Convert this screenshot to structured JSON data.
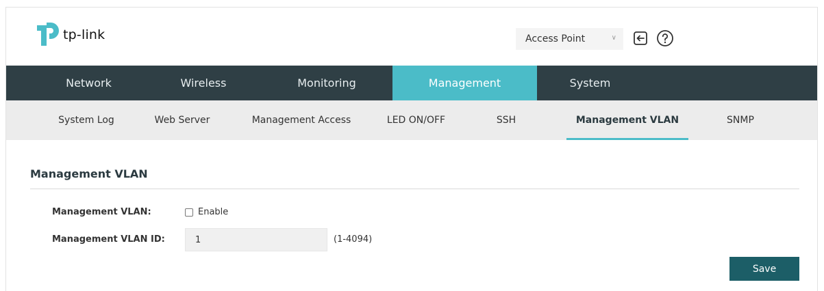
{
  "brand": {
    "name": "tp-link",
    "accent_color": "#4bbcc8",
    "logo_color": "#4bbcc8"
  },
  "header": {
    "mode_select": {
      "value": "Access Point"
    },
    "logout_icon": "logout-icon",
    "help_icon": "help-icon"
  },
  "nav": {
    "tabs": [
      {
        "label": "Network"
      },
      {
        "label": "Wireless"
      },
      {
        "label": "Monitoring"
      },
      {
        "label": "Management",
        "active": true
      },
      {
        "label": "System"
      }
    ],
    "subtabs": [
      {
        "label": "System Log"
      },
      {
        "label": "Web Server"
      },
      {
        "label": "Management Access"
      },
      {
        "label": "LED ON/OFF"
      },
      {
        "label": "SSH"
      },
      {
        "label": "Management VLAN",
        "active": true
      },
      {
        "label": "SNMP"
      }
    ]
  },
  "content": {
    "section_title": "Management VLAN",
    "vlan_label": "Management VLAN:",
    "enable_label": "Enable",
    "enable_checked": false,
    "vlan_id_label": "Management VLAN ID:",
    "vlan_id_value": "1",
    "vlan_id_range": "(1-4094)",
    "save_label": "Save"
  }
}
